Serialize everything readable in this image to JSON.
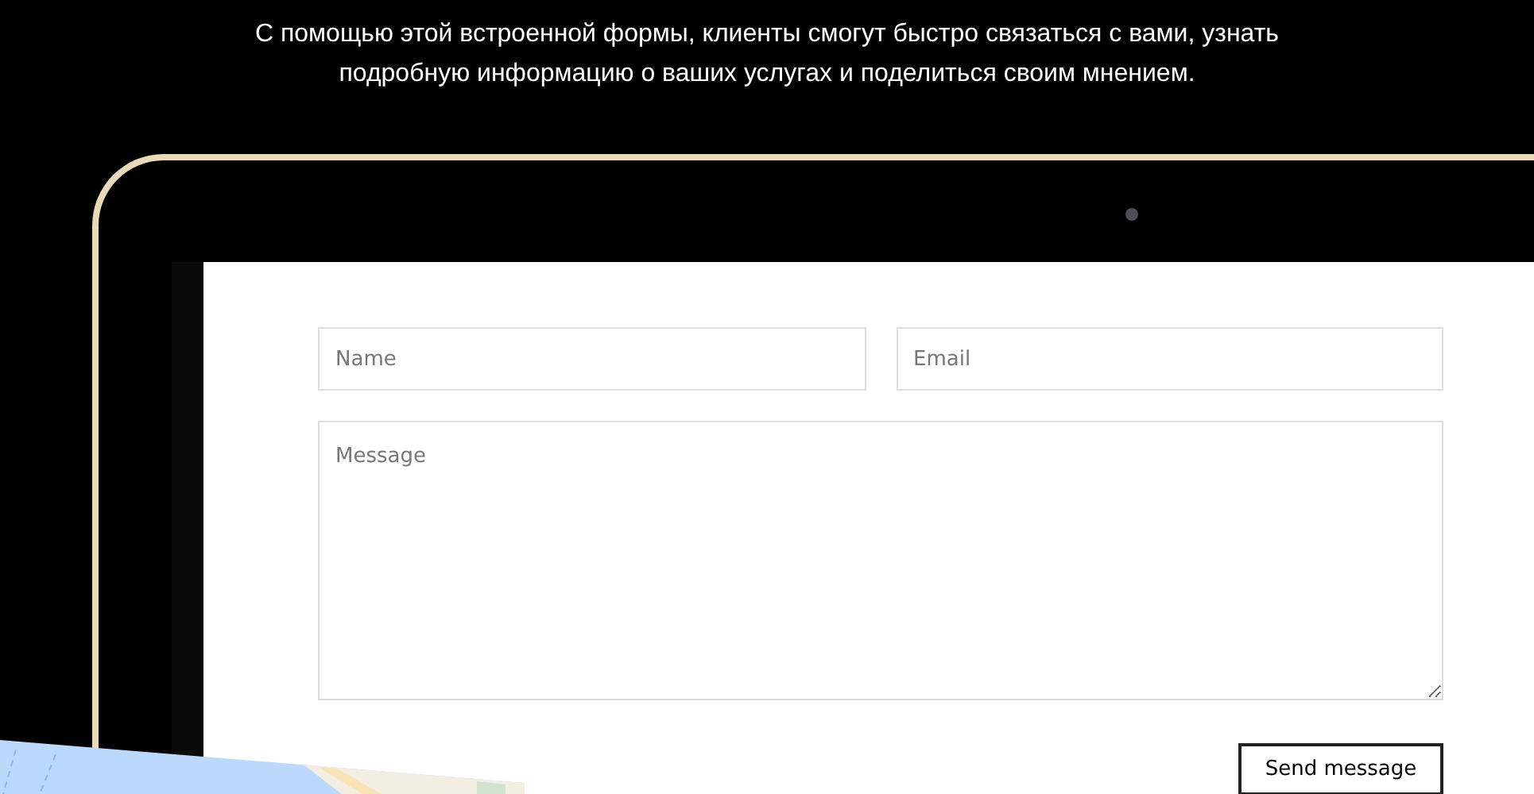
{
  "intro": "С помощью этой встроенной формы, клиенты смогут быстро связаться с вами, узнать подробную информацию о ваших услугах и поделиться своим мнением.",
  "form": {
    "fields": [
      {
        "placeholder": "Name"
      },
      {
        "placeholder": "Email"
      }
    ],
    "message": {
      "placeholder": "Message"
    },
    "submit": "Send message"
  }
}
